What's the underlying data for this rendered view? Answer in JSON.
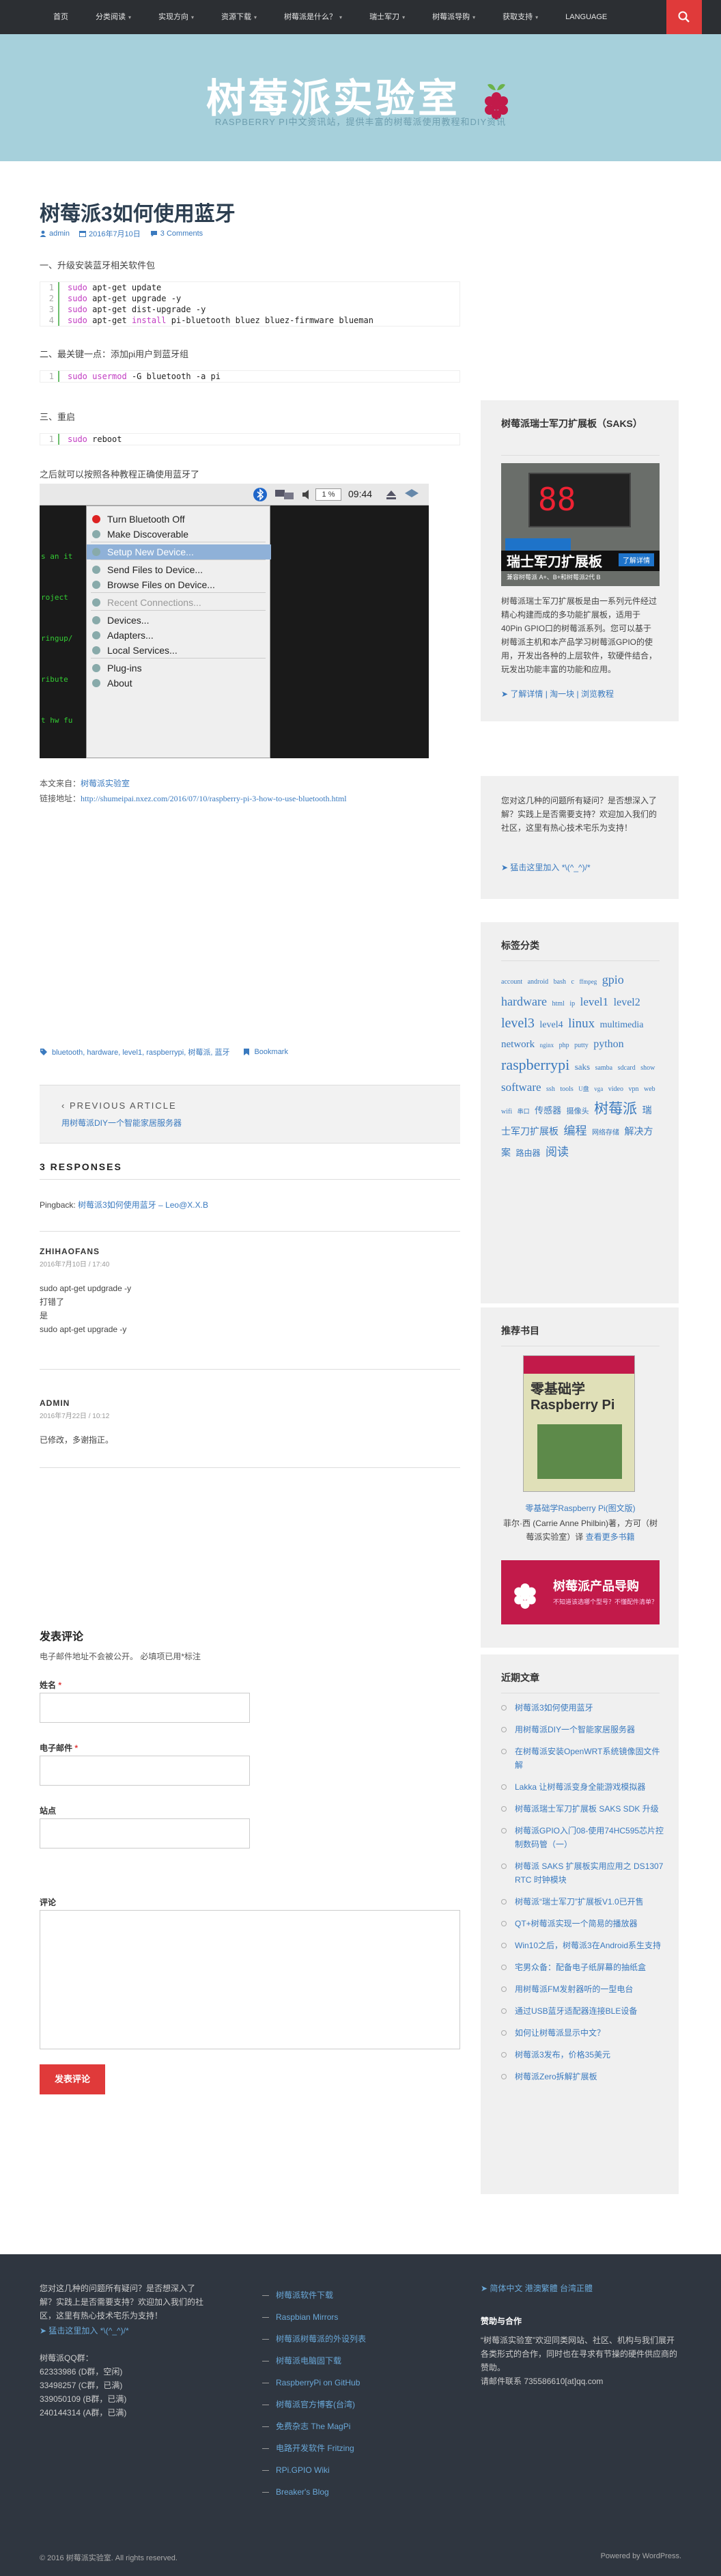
{
  "nav": {
    "items": [
      {
        "label": "首页",
        "caret": false
      },
      {
        "label": "分类阅读",
        "caret": true
      },
      {
        "label": "实现方向",
        "caret": true
      },
      {
        "label": "资源下载",
        "caret": true
      },
      {
        "label": "树莓派是什么？",
        "caret": true
      },
      {
        "label": "瑞士军刀",
        "caret": true
      },
      {
        "label": "树莓派导购",
        "caret": true
      },
      {
        "label": "获取支持",
        "caret": true
      },
      {
        "label": "LANGUAGE",
        "caret": false
      }
    ]
  },
  "header": {
    "title": "树莓派实验室",
    "description": "RASPBERRY PI中文资讯站，提供丰富的树莓派使用教程和DIY资讯"
  },
  "post": {
    "title": "树莓派3如何使用蓝牙",
    "author": "admin",
    "date": "2016年7月10日",
    "comments": "3 Comments",
    "step1": "一、升级安装蓝牙相关软件包",
    "code1": [
      {
        "ln": "1",
        "kw": "sudo",
        "rest": " apt-get update"
      },
      {
        "ln": "2",
        "kw": "sudo",
        "rest": " apt-get upgrade -y"
      },
      {
        "ln": "3",
        "kw": "sudo",
        "rest": " apt-get dist-upgrade -y"
      },
      {
        "ln": "4",
        "kw": "sudo",
        "rest": " apt-get ",
        "kw2": "install",
        "rest2": " pi-bluetooth bluez bluez-firmware blueman"
      }
    ],
    "step2": "二、最关键一点：添加pi用户到蓝牙组",
    "code2": {
      "ln": "1",
      "kw": "sudo",
      "kw2": "usermod",
      "rest": " -G bluetooth -a pi"
    },
    "step3": "三、重启",
    "code3": {
      "ln": "1",
      "kw": "sudo",
      "rest": " reboot"
    },
    "after": "之后就可以按照各种教程正确使用蓝牙了",
    "screenshot": {
      "clock": "09:44",
      "volume": "1 %",
      "menu": [
        {
          "label": "Turn Bluetooth Off",
          "state": "normal"
        },
        {
          "label": "Make Discoverable",
          "state": "normal"
        },
        {
          "label": "Setup New Device...",
          "state": "sel"
        },
        {
          "label": "Send Files to Device...",
          "state": "normal"
        },
        {
          "label": "Browse Files on Device...",
          "state": "normal"
        },
        {
          "label": "Recent Connections...",
          "state": "dis"
        },
        {
          "label": "Devices...",
          "state": "normal"
        },
        {
          "label": "Adapters...",
          "state": "normal"
        },
        {
          "label": "Local Services...",
          "state": "normal"
        },
        {
          "label": "Plug-ins",
          "state": "normal"
        },
        {
          "label": "About",
          "state": "normal"
        }
      ],
      "terminal_lines": [
        "s an it",
        "roject",
        "ringup/",
        "ribute",
        "t hw fu"
      ]
    },
    "source_label": "本文来自：",
    "source_name": "树莓派实验室",
    "link_label": "链接地址：",
    "link_url": "http://shumeipai.nxez.com/2016/07/10/raspberry-pi-3-how-to-use-bluetooth.html",
    "tags": "bluetooth, hardware, level1, raspberrypi, 树莓派, 蓝牙",
    "bookmark": "Bookmark",
    "prev_label": "PREVIOUS ARTICLE",
    "prev_link": "用树莓派DIY一个智能家居服务器"
  },
  "responses": {
    "heading": "3 RESPONSES",
    "pingback_label": "Pingback:",
    "pingback_link": "树莓派3如何使用蓝牙 – Leo@X.X.B",
    "c1_author": "ZHIHAOFANS",
    "c1_date": "2016年7月10日 / 17:40",
    "c1_lines": [
      "sudo apt-get updgrade -y",
      "打错了",
      "是",
      "sudo apt-get upgrade -y"
    ],
    "c2_author": "ADMIN",
    "c2_date": "2016年7月22日 / 10:12",
    "c2_text": "已修改，多谢指正。"
  },
  "form": {
    "heading": "发表评论",
    "note": "电子邮件地址不会被公开。 必填项已用*标注",
    "name_label": "姓名",
    "email_label": "电子邮件",
    "site_label": "站点",
    "comment_label": "评论",
    "required": "*",
    "submit": "发表评论"
  },
  "sidebar": {
    "saks": {
      "title": "树莓派瑞士军刀扩展板（SAKS）",
      "img_title": "瑞士军刀扩展板",
      "img_sub": "兼容树莓派 A+、B+和树莓派2代 B",
      "img_badge": "了解详情",
      "text": "树莓派瑞士军刀扩展板是由一系列元件经过精心构建而成的多功能扩展板，适用于40Pin GPIO口的树莓派系列。您可以基于树莓派主机和本产品学习树莓派GPIO的使用，开发出各种的上层软件，软硬件结合，玩发出功能丰富的功能和应用。",
      "links": "➤ 了解详情 | 淘一块 | 浏览教程"
    },
    "qa": {
      "text": "您对这几种的问题所有疑问？是否想深入了解？实践上是否需要支持？欢迎加入我们的社区，这里有热心技术宅乐为支持！",
      "link": "➤ 猛击这里加入 *\\(^_^)/*"
    },
    "tagcloud": {
      "title": "标签分类",
      "tags": [
        {
          "t": "account",
          "s": 10
        },
        {
          "t": "android",
          "s": 10
        },
        {
          "t": "bash",
          "s": 10
        },
        {
          "t": "c",
          "s": 10
        },
        {
          "t": "ffmpeg",
          "s": 9
        },
        {
          "t": "gpio",
          "s": 18
        },
        {
          "t": "hardware",
          "s": 18
        },
        {
          "t": "html",
          "s": 10
        },
        {
          "t": "ip",
          "s": 10
        },
        {
          "t": "level1",
          "s": 17
        },
        {
          "t": "level2",
          "s": 16
        },
        {
          "t": "level3",
          "s": 20
        },
        {
          "t": "level4",
          "s": 14
        },
        {
          "t": "linux",
          "s": 19
        },
        {
          "t": "multimedia",
          "s": 14
        },
        {
          "t": "network",
          "s": 15
        },
        {
          "t": "nginx",
          "s": 9
        },
        {
          "t": "php",
          "s": 10
        },
        {
          "t": "putty",
          "s": 10
        },
        {
          "t": "python",
          "s": 16
        },
        {
          "t": "raspberrypi",
          "s": 22
        },
        {
          "t": "saks",
          "s": 13
        },
        {
          "t": "samba",
          "s": 10
        },
        {
          "t": "sdcard",
          "s": 10
        },
        {
          "t": "show",
          "s": 10
        },
        {
          "t": "software",
          "s": 17
        },
        {
          "t": "ssh",
          "s": 10
        },
        {
          "t": "tools",
          "s": 10
        },
        {
          "t": "U盘",
          "s": 9
        },
        {
          "t": "vga",
          "s": 9
        },
        {
          "t": "video",
          "s": 10
        },
        {
          "t": "vpn",
          "s": 10
        },
        {
          "t": "web",
          "s": 10
        },
        {
          "t": "wifi",
          "s": 10
        },
        {
          "t": "串口",
          "s": 9
        },
        {
          "t": "传感器",
          "s": 13
        },
        {
          "t": "摄像头",
          "s": 11
        },
        {
          "t": "树莓派",
          "s": 21
        },
        {
          "t": "瑞士军刀扩展板",
          "s": 14
        },
        {
          "t": "编程",
          "s": 17
        },
        {
          "t": "网络存储",
          "s": 10
        },
        {
          "t": "解决方案",
          "s": 14
        },
        {
          "t": "路由器",
          "s": 12
        },
        {
          "t": "阅读",
          "s": 17
        }
      ]
    },
    "books": {
      "title": "推荐书目",
      "book_title": "零基础学Raspberry Pi",
      "book_caption_link": "零基础学Raspberry Pi(图文版)",
      "book_desc": "菲尔·西 (Carrie Anne Philbin)著，方可（树莓派实验室）译",
      "book_more": "查看更多书籍",
      "banner_title": "树莓派产品导购",
      "banner_sub": "不知道该选哪个型号？不懂配件清单？"
    },
    "recent": {
      "title": "近期文章",
      "items": [
        "树莓派3如何使用蓝牙",
        "用树莓派DIY一个智能家居服务器",
        "在树莓派安装OpenWRT系统镜像固文件解",
        "Lakka 让树莓派变身全能游戏模拟器",
        "树莓派瑞士军刀扩展板 SAKS SDK 升级",
        "树莓派GPIO入门08-使用74HC595芯片控制数码管（一）",
        "树莓派 SAKS 扩展板实用应用之 DS1307 RTC 时钟模块",
        "树莓派“瑞士军刀”扩展板V1.0已开售",
        "QT+树莓派实现一个简易的播放器",
        "Win10之后，树莓派3在Android系生支持",
        "宅男众备：配备电子纸屏幕的抽纸盒",
        "用树莓派FM发射器听的一型电台",
        "通过USB蓝牙适配器连接BLE设备",
        "如何让树莓派显示中文？",
        "树莓派3发布，价格35美元",
        "树莓派Zero拆解扩展板"
      ]
    }
  },
  "footer": {
    "qa_text": "您对这几种的问题所有疑问？是否想深入了解？实践上是否需要支持？欢迎加入我们的社区，这里有热心技术宅乐为支持！",
    "qa_link": "➤ 猛击这里加入 *\\(^_^)/*",
    "qq_title": "树莓派QQ群：",
    "qq_lines": [
      "62333986 (D群，空闲)",
      "33498257 (C群，已满)",
      "339050109 (B群，已满)",
      "240144314 (A群，已满)"
    ],
    "links": [
      "树莓派软件下载",
      "Raspbian Mirrors",
      "树莓派树莓派的外设列表",
      "树莓派电脑固下载",
      "RaspberryPi on GitHub",
      "树莓派官方博客(台湾)",
      "免费杂志 The MagPi",
      "电路开发软件 Fritzing",
      "RPi.GPIO Wiki",
      "Breaker's Blog"
    ],
    "lang": "➤ 简体中文 港澳繁體 台湾正體",
    "sponsor_title": "赞助与合作",
    "sponsor_text": "“树莓派实验室”欢迎同类网站、社区、机构与我们展开各类形式的合作，同时也在寻求有节操的硬件供应商的赞助。",
    "sponsor_contact": "请邮件联系 735586610[at]qq.com",
    "copyright": "© 2016 树莓派实验室. All rights reserved.",
    "powered": "Powered by WordPress."
  },
  "colors": {
    "accent": "#e03a3a",
    "link": "#3a7abf",
    "header_bg": "#a6d0db",
    "footer_bg": "#2f3640"
  }
}
